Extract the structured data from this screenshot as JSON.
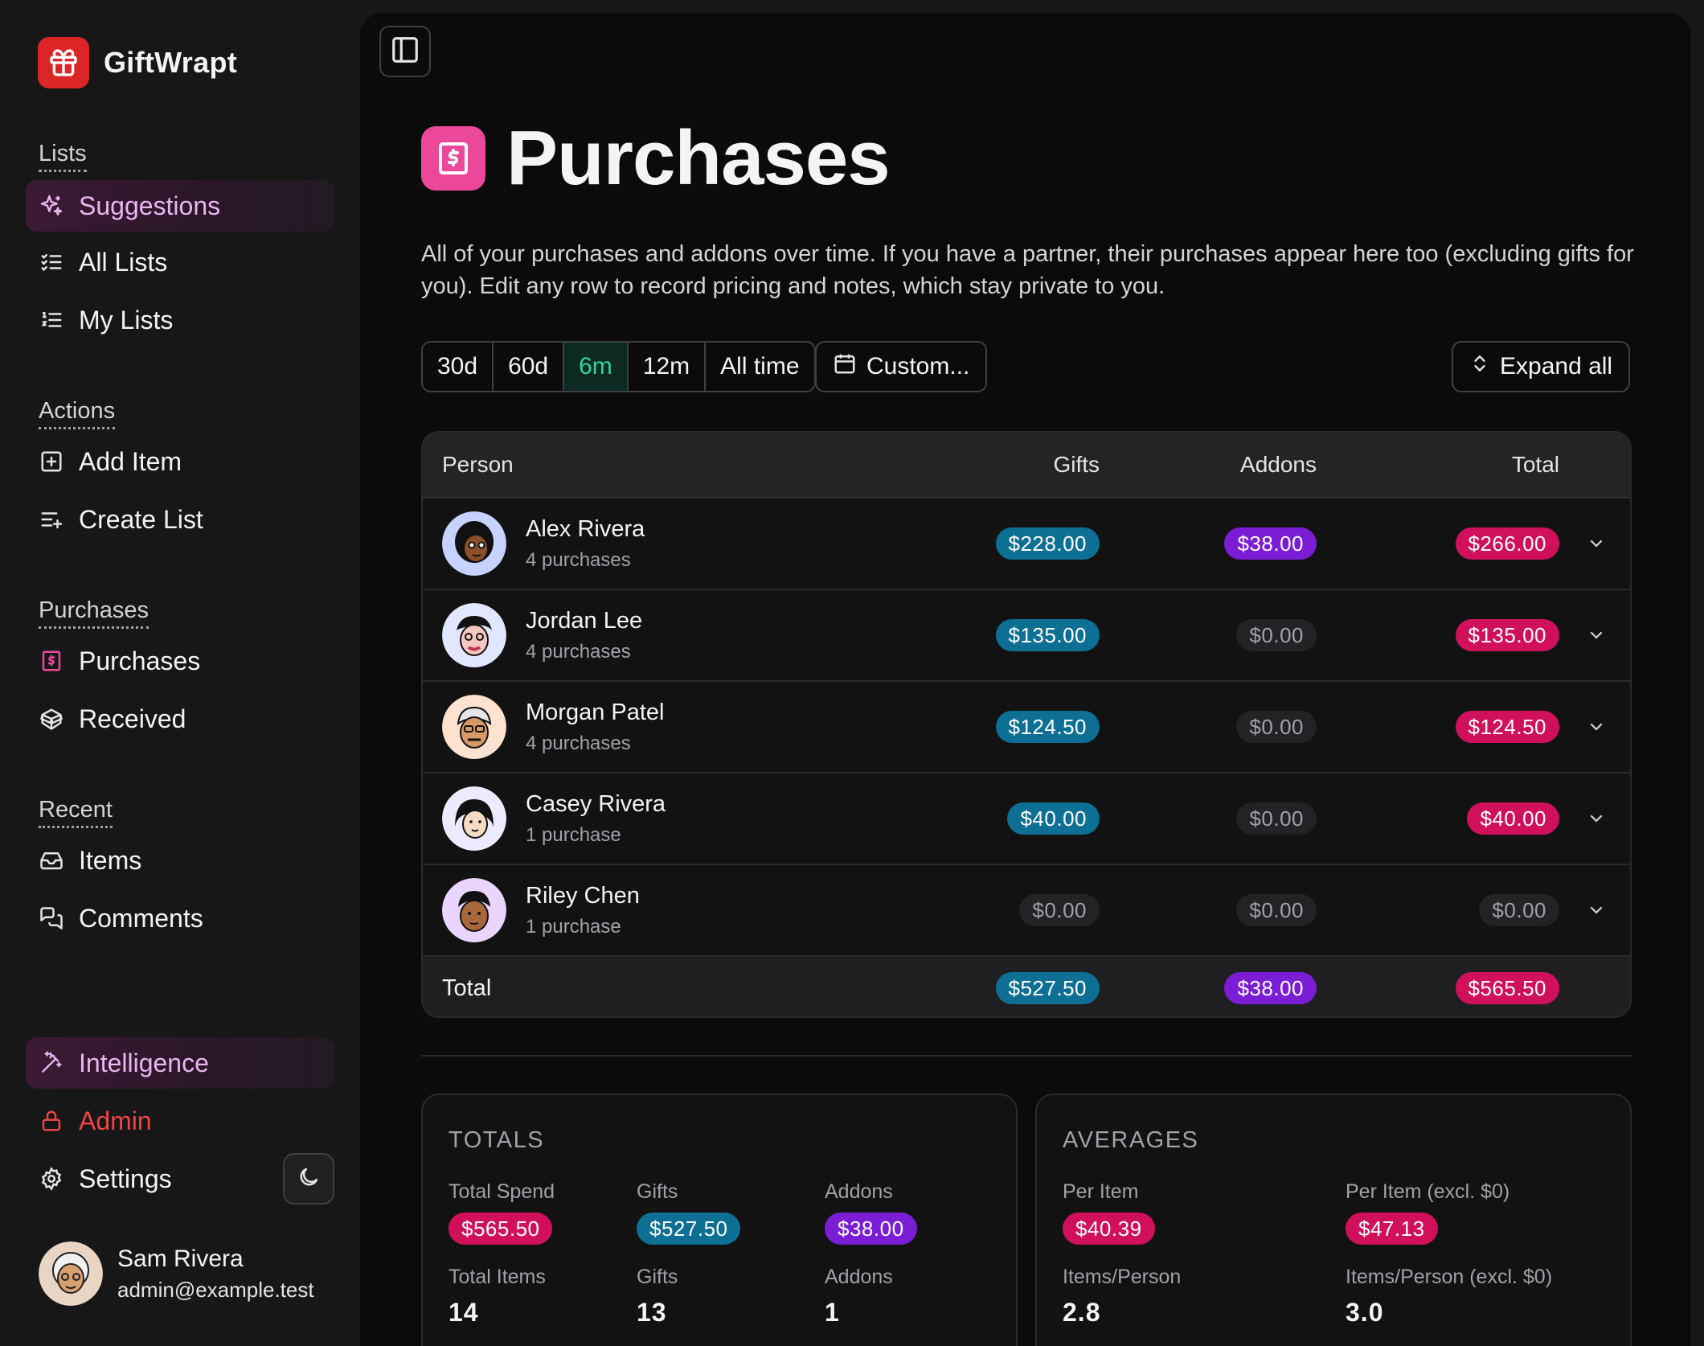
{
  "brand": {
    "name": "GiftWrapt"
  },
  "sidebar": {
    "sections": {
      "lists": "Lists",
      "actions": "Actions",
      "purchases": "Purchases",
      "recent": "Recent"
    },
    "items": {
      "suggestions": "Suggestions",
      "all_lists": "All Lists",
      "my_lists": "My Lists",
      "add_item": "Add Item",
      "create_list": "Create List",
      "purchases": "Purchases",
      "received": "Received",
      "items": "Items",
      "comments": "Comments",
      "intelligence": "Intelligence",
      "admin": "Admin",
      "settings": "Settings"
    },
    "user": {
      "name": "Sam Rivera",
      "email": "admin@example.test"
    }
  },
  "page": {
    "title": "Purchases",
    "description": "All of your purchases and addons over time. If you have a partner, their purchases appear here too (excluding gifts for you). Edit any row to record pricing and notes, which stay private to you."
  },
  "filters": {
    "ranges": [
      "30d",
      "60d",
      "6m",
      "12m",
      "All time"
    ],
    "selected": "6m",
    "custom_label": "Custom...",
    "expand_label": "Expand all"
  },
  "table": {
    "headers": {
      "person": "Person",
      "gifts": "Gifts",
      "addons": "Addons",
      "total": "Total"
    },
    "rows": [
      {
        "name": "Alex Rivera",
        "sub": "4 purchases",
        "gifts": "$228.00",
        "addons": "$38.00",
        "total": "$266.00"
      },
      {
        "name": "Jordan Lee",
        "sub": "4 purchases",
        "gifts": "$135.00",
        "addons": "$0.00",
        "total": "$135.00"
      },
      {
        "name": "Morgan Patel",
        "sub": "4 purchases",
        "gifts": "$124.50",
        "addons": "$0.00",
        "total": "$124.50"
      },
      {
        "name": "Casey Rivera",
        "sub": "1 purchase",
        "gifts": "$40.00",
        "addons": "$0.00",
        "total": "$40.00"
      },
      {
        "name": "Riley Chen",
        "sub": "1 purchase",
        "gifts": "$0.00",
        "addons": "$0.00",
        "total": "$0.00"
      }
    ],
    "footer": {
      "label": "Total",
      "gifts": "$527.50",
      "addons": "$38.00",
      "total": "$565.50"
    }
  },
  "totals": {
    "title": "TOTALS",
    "total_spend_label": "Total Spend",
    "total_spend": "$565.50",
    "gifts_label": "Gifts",
    "gifts": "$527.50",
    "addons_label": "Addons",
    "addons": "$38.00",
    "total_items_label": "Total Items",
    "total_items": "14",
    "gift_items_label": "Gifts",
    "gift_items": "13",
    "addon_items_label": "Addons",
    "addon_items": "1"
  },
  "averages": {
    "title": "AVERAGES",
    "per_item_label": "Per Item",
    "per_item": "$40.39",
    "per_item_excl_label": "Per Item (excl. $0)",
    "per_item_excl": "$47.13",
    "items_person_label": "Items/Person",
    "items_person": "2.8",
    "items_person_excl_label": "Items/Person (excl. $0)",
    "items_person_excl": "3.0"
  },
  "colors": {
    "accent_pink": "#ec4899",
    "gifts_pill": "#0e6f94",
    "addons_pill": "#7c1dd6",
    "total_pill": "#d1105c",
    "range_selected": "#34d399",
    "admin_red": "#ef4444",
    "brand_red": "#dc2626"
  }
}
